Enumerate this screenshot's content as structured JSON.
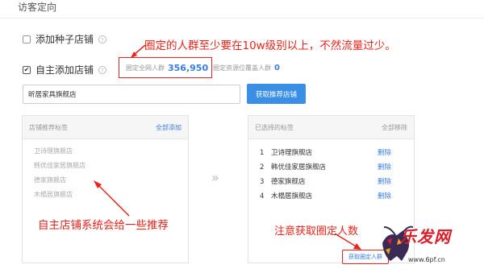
{
  "page": {
    "title": "访客定向"
  },
  "options": {
    "seed_shop": {
      "label": "添加种子店铺",
      "checked": false
    },
    "custom_shop": {
      "label": "自主添加店铺",
      "checked": true
    }
  },
  "annotations": {
    "top": "圈定的人群至少要在10w级别以上，不然流量过少。",
    "left": "自主店铺系统会给一些推荐",
    "right": "注意获取圈定人数"
  },
  "audience": {
    "label": "圈定全网人群",
    "value": "356,950"
  },
  "coverage": {
    "label": "圈定资源位覆盖人群",
    "value": "0"
  },
  "search": {
    "value": "昕居家具旗舰店",
    "button_label": "获取推荐店铺"
  },
  "left_panel": {
    "title": "店铺推荐标签",
    "action": "全部添加",
    "items": [
      "卫诗理旗舰店",
      "韩优佳家居旗舰店",
      "德家旗舰店",
      "木榻居旗舰店"
    ]
  },
  "right_panel": {
    "title": "已选择的标签",
    "action": "全部移除",
    "items": [
      {
        "num": "1",
        "name": "卫诗理旗舰店",
        "action": "删除"
      },
      {
        "num": "2",
        "name": "韩优佳家居旗舰店",
        "action": "删除"
      },
      {
        "num": "3",
        "name": "德家旗舰店",
        "action": "删除"
      },
      {
        "num": "4",
        "name": "木榻居旗舰店",
        "action": "删除"
      }
    ]
  },
  "transfer_icon": "»",
  "bottom_button": {
    "label": "获取圈定人群"
  },
  "watermark": {
    "brand": "乐发网",
    "url": "www.6pf.cn"
  },
  "colors": {
    "annotation": "#e8241c",
    "link": "#3a7de0",
    "primary": "#3a8ee6"
  }
}
